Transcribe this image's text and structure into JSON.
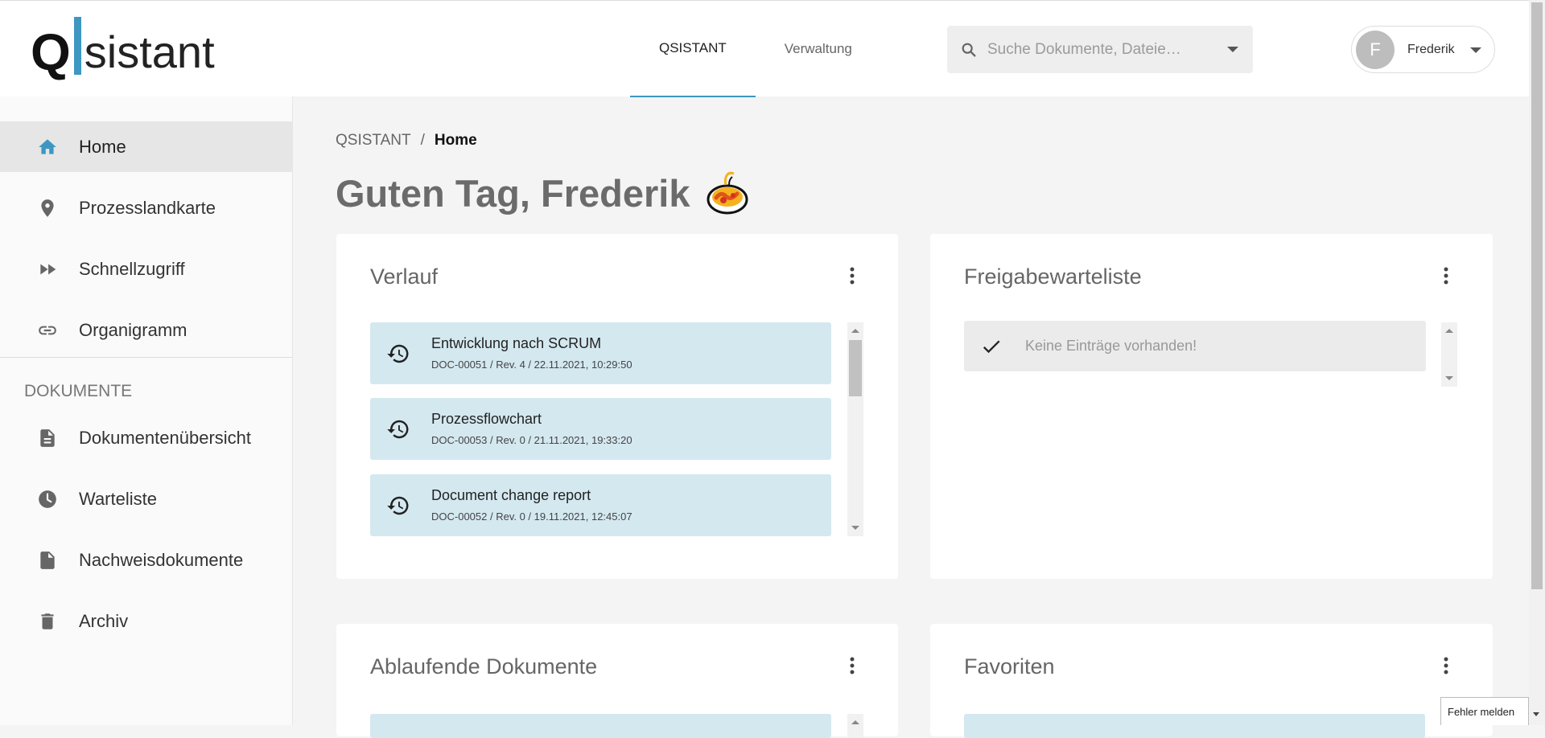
{
  "app": {
    "logo_letter": "Q",
    "logo_text": "sistant",
    "accent_color": "#3d97c2"
  },
  "topnav": {
    "items": [
      {
        "label": "QSISTANT",
        "active": true
      },
      {
        "label": "Verwaltung",
        "active": false
      }
    ]
  },
  "search": {
    "placeholder": "Suche Dokumente, Dateie…",
    "icon": "search-icon"
  },
  "user": {
    "initial": "F",
    "name": "Frederik"
  },
  "sidebar": {
    "items": [
      {
        "label": "Home",
        "icon": "home-icon",
        "active": true
      },
      {
        "label": "Prozesslandkarte",
        "icon": "map-pin-icon",
        "active": false
      },
      {
        "label": "Schnellzugriff",
        "icon": "fast-forward-icon",
        "active": false
      },
      {
        "label": "Organigramm",
        "icon": "link-icon",
        "active": false
      }
    ],
    "section_title": "DOKUMENTE",
    "doc_items": [
      {
        "label": "Dokumentenübersicht",
        "icon": "document-icon"
      },
      {
        "label": "Warteliste",
        "icon": "clock-icon"
      },
      {
        "label": "Nachweisdokumente",
        "icon": "file-icon"
      },
      {
        "label": "Archiv",
        "icon": "trash-icon"
      }
    ]
  },
  "breadcrumb": {
    "root": "QSISTANT",
    "separator": "/",
    "current": "Home"
  },
  "greeting": "Guten Tag, Frederik",
  "cards": {
    "verlauf": {
      "title": "Verlauf",
      "items": [
        {
          "title": "Entwicklung nach SCRUM",
          "sub": "DOC-00051 / Rev. 4 / 22.11.2021, 10:29:50"
        },
        {
          "title": "Prozessflowchart",
          "sub": "DOC-00053 / Rev. 0 / 21.11.2021, 19:33:20"
        },
        {
          "title": "Document change report",
          "sub": "DOC-00052 / Rev. 0 / 19.11.2021, 12:45:07"
        }
      ]
    },
    "freigabe": {
      "title": "Freigabewarteliste",
      "empty_text": "Keine Einträge vorhanden!"
    },
    "ablaufend": {
      "title": "Ablaufende Dokumente"
    },
    "favoriten": {
      "title": "Favoriten"
    }
  },
  "report_button": "Fehler melden"
}
